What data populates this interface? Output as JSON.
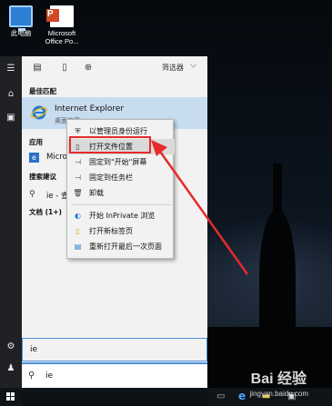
{
  "desktop": {
    "icons": [
      {
        "label": "此电脑",
        "icon": "this-pc-icon"
      },
      {
        "label": "Microsoft\nOffice Po...",
        "icon": "powerpoint-icon"
      }
    ]
  },
  "rail": {
    "icons": [
      "hamburger-icon",
      "home-icon",
      "documents-icon",
      "settings-icon",
      "user-icon",
      "windows-icon"
    ]
  },
  "panel": {
    "filters_label": "筛选器",
    "sections": {
      "best_match": "最佳匹配",
      "apps": "应用",
      "search_suggestions": "搜索建议",
      "documents": "文档 (1+)"
    },
    "best_match": {
      "title": "Internet Explorer",
      "subtitle": "桌面应用"
    },
    "app_item": "Micro",
    "suggestion": "ie - 查"
  },
  "search": {
    "result_text": "ie",
    "query": "ie"
  },
  "context_menu": {
    "items": [
      {
        "label": "以管理员身份运行",
        "icon": "admin-shield-icon"
      },
      {
        "label": "打开文件位置",
        "icon": "file-location-icon"
      },
      {
        "label": "固定到\"开始\"屏幕",
        "icon": "pin-icon"
      },
      {
        "label": "固定到任务栏",
        "icon": "pin-icon"
      },
      {
        "label": "卸载",
        "icon": "trash-icon"
      },
      {
        "label": "开始 InPrivate 浏览",
        "icon": "inprivate-icon"
      },
      {
        "label": "打开新标签页",
        "icon": "new-tab-icon"
      },
      {
        "label": "重新打开最后一次页面",
        "icon": "reopen-icon"
      }
    ],
    "highlighted_index": 1
  },
  "watermark": {
    "main": "Bai 经验",
    "sub": "jingyan.baidu.com"
  },
  "colors": {
    "highlight_red": "#e52b2b",
    "selection_blue": "#c8dcef",
    "accent_blue": "#4a8fd8"
  }
}
